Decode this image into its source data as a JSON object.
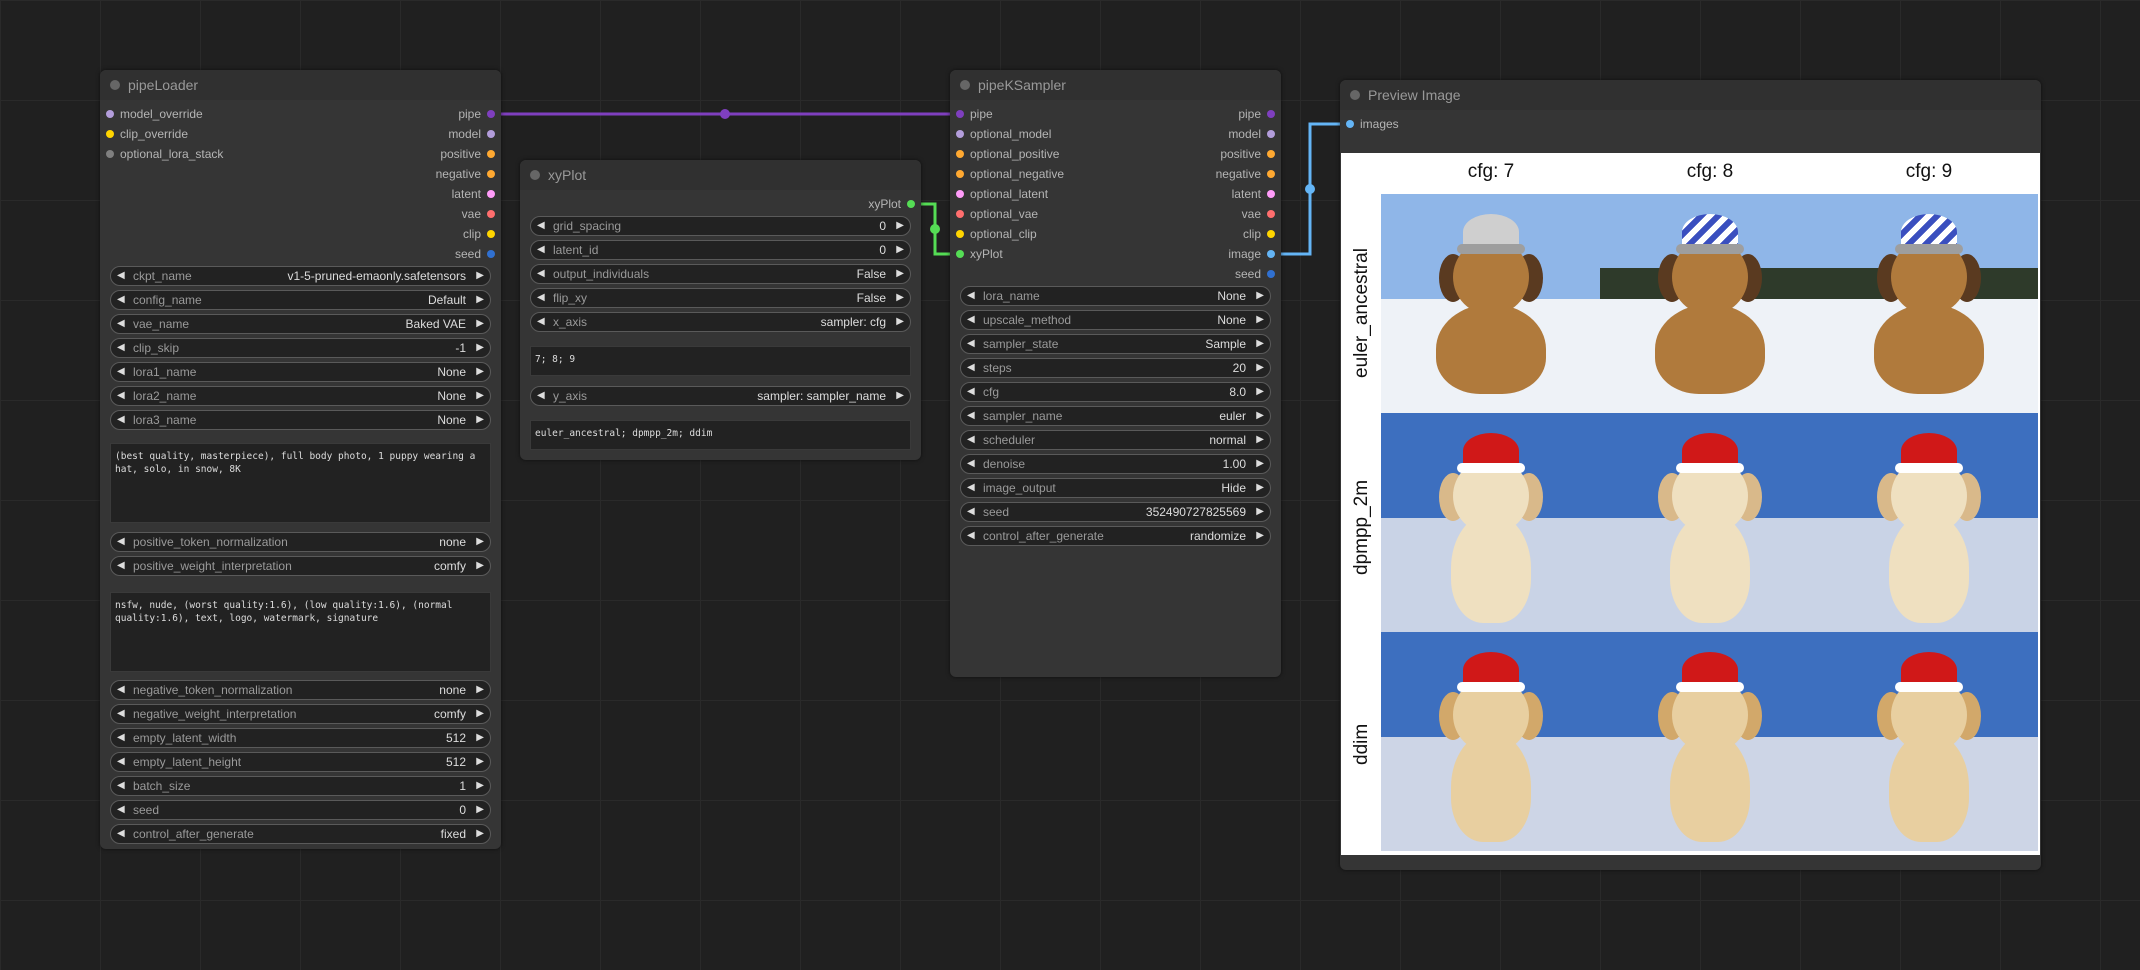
{
  "pipeLoader": {
    "title": "pipeLoader",
    "inputs": [
      "model_override",
      "clip_override",
      "optional_lora_stack"
    ],
    "input_colors": [
      "#b39ddb",
      "#ffd500",
      "#808080"
    ],
    "outputs": [
      "pipe",
      "model",
      "positive",
      "negative",
      "latent",
      "vae",
      "clip",
      "seed"
    ],
    "output_colors": [
      "#7f3fbf",
      "#b39ddb",
      "#ffa931",
      "#ffa931",
      "#ff9cf9",
      "#ff6e6e",
      "#ffd500",
      "#3070d0"
    ],
    "widgets1": [
      {
        "label": "ckpt_name",
        "value": "v1-5-pruned-emaonly.safetensors"
      },
      {
        "label": "config_name",
        "value": "Default"
      },
      {
        "label": "vae_name",
        "value": "Baked VAE"
      },
      {
        "label": "clip_skip",
        "value": "-1"
      },
      {
        "label": "lora1_name",
        "value": "None"
      },
      {
        "label": "lora2_name",
        "value": "None"
      },
      {
        "label": "lora3_name",
        "value": "None"
      }
    ],
    "positive_text": "(best quality, masterpiece), full body photo, 1 puppy wearing a hat, solo, in snow, 8K",
    "widgets2": [
      {
        "label": "positive_token_normalization",
        "value": "none"
      },
      {
        "label": "positive_weight_interpretation",
        "value": "comfy"
      }
    ],
    "negative_text": "nsfw, nude, (worst quality:1.6), (low quality:1.6), (normal quality:1.6), text, logo, watermark, signature",
    "widgets3": [
      {
        "label": "negative_token_normalization",
        "value": "none"
      },
      {
        "label": "negative_weight_interpretation",
        "value": "comfy"
      },
      {
        "label": "empty_latent_width",
        "value": "512"
      },
      {
        "label": "empty_latent_height",
        "value": "512"
      },
      {
        "label": "batch_size",
        "value": "1"
      },
      {
        "label": "seed",
        "value": "0"
      },
      {
        "label": "control_after_generate",
        "value": "fixed"
      }
    ]
  },
  "xyPlot": {
    "title": "xyPlot",
    "output": "xyPlot",
    "output_color": "#55dd55",
    "widgets1": [
      {
        "label": "grid_spacing",
        "value": "0"
      },
      {
        "label": "latent_id",
        "value": "0"
      },
      {
        "label": "output_individuals",
        "value": "False"
      },
      {
        "label": "flip_xy",
        "value": "False"
      },
      {
        "label": "x_axis",
        "value": "sampler: cfg"
      }
    ],
    "x_values": "7; 8; 9",
    "widgets2": [
      {
        "label": "y_axis",
        "value": "sampler: sampler_name"
      }
    ],
    "y_values": "euler_ancestral; dpmpp_2m; ddim"
  },
  "pipeKSampler": {
    "title": "pipeKSampler",
    "inputs": [
      "pipe",
      "optional_model",
      "optional_positive",
      "optional_negative",
      "optional_latent",
      "optional_vae",
      "optional_clip",
      "xyPlot"
    ],
    "input_colors": [
      "#7f3fbf",
      "#b39ddb",
      "#ffa931",
      "#ffa931",
      "#ff9cf9",
      "#ff6e6e",
      "#ffd500",
      "#55dd55"
    ],
    "outputs": [
      "pipe",
      "model",
      "positive",
      "negative",
      "latent",
      "vae",
      "clip",
      "image",
      "seed"
    ],
    "output_colors": [
      "#7f3fbf",
      "#b39ddb",
      "#ffa931",
      "#ffa931",
      "#ff9cf9",
      "#ff6e6e",
      "#ffd500",
      "#64b5f6",
      "#3070d0"
    ],
    "widgets": [
      {
        "label": "lora_name",
        "value": "None"
      },
      {
        "label": "upscale_method",
        "value": "None"
      },
      {
        "label": "sampler_state",
        "value": "Sample"
      },
      {
        "label": "steps",
        "value": "20"
      },
      {
        "label": "cfg",
        "value": "8.0"
      },
      {
        "label": "sampler_name",
        "value": "euler"
      },
      {
        "label": "scheduler",
        "value": "normal"
      },
      {
        "label": "denoise",
        "value": "1.00"
      },
      {
        "label": "image_output",
        "value": "Hide"
      },
      {
        "label": "seed",
        "value": "352490727825569"
      },
      {
        "label": "control_after_generate",
        "value": "randomize"
      }
    ]
  },
  "previewImage": {
    "title": "Preview Image",
    "input": "images",
    "input_color": "#64b5f6",
    "col_labels": [
      "cfg: 7",
      "cfg: 8",
      "cfg: 9"
    ],
    "row_labels": [
      "euler_ancestral",
      "dpmpp_2m",
      "ddim"
    ]
  },
  "colors": {
    "pipe_link": "#7f3fbf",
    "xyplot_link": "#55dd55",
    "image_link": "#64b5f6"
  }
}
